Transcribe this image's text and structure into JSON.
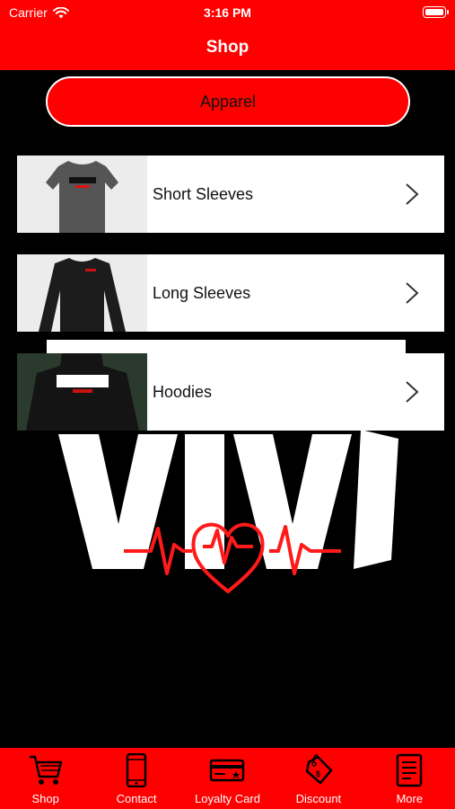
{
  "status_bar": {
    "carrier": "Carrier",
    "time": "3:16 PM"
  },
  "header": {
    "title": "Shop"
  },
  "category_button": {
    "label": "Apparel"
  },
  "list": {
    "items": [
      {
        "label": "Short Sleeves",
        "thumb_icon": "short-sleeve-shirt-icon"
      },
      {
        "label": "Long Sleeves",
        "thumb_icon": "long-sleeve-shirt-icon"
      },
      {
        "label": "Hoodies",
        "thumb_icon": "hoodie-icon"
      }
    ]
  },
  "tabbar": {
    "items": [
      {
        "label": "Shop",
        "icon": "cart-icon"
      },
      {
        "label": "Contact",
        "icon": "phone-icon"
      },
      {
        "label": "Loyalty Card",
        "icon": "card-icon"
      },
      {
        "label": "Discount",
        "icon": "tag-icon"
      },
      {
        "label": "More",
        "icon": "document-icon"
      }
    ]
  },
  "colors": {
    "brand": "#ff0000",
    "background": "#000000",
    "text": "#ffffff"
  }
}
